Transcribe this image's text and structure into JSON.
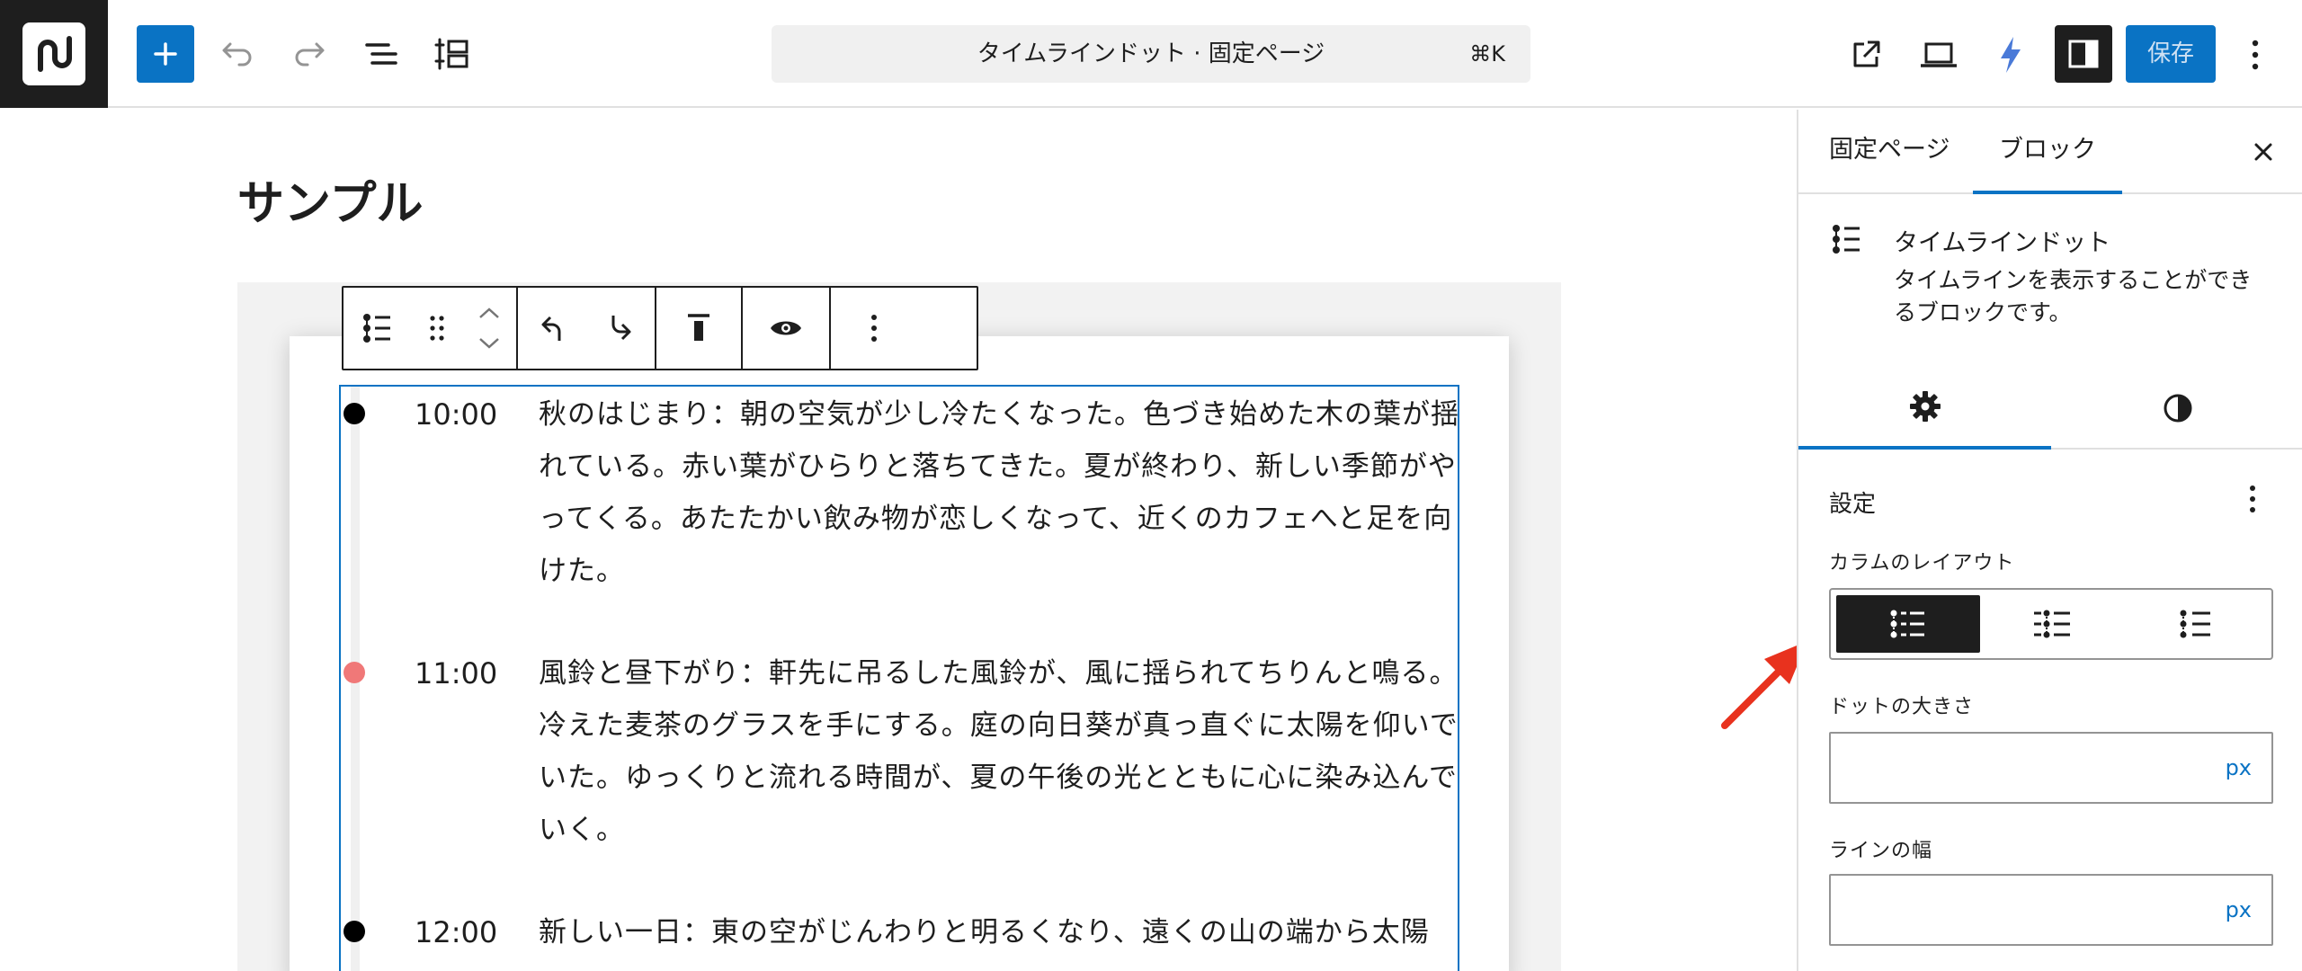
{
  "toolbar": {
    "command_title": "タイムラインドット · 固定ページ",
    "command_shortcut": "⌘K",
    "save_label": "保存"
  },
  "editor": {
    "page_title": "サンプル",
    "timeline": [
      {
        "time": "10:00",
        "text": "秋のはじまり：朝の空気が少し冷たくなった。色づき始めた木の葉が揺れている。赤い葉がひらりと落ちてきた。夏が終わり、新しい季節がやってくる。あたたかい飲み物が恋しくなって、近くのカフェへと足を向けた。",
        "dot_color": "#000000"
      },
      {
        "time": "11:00",
        "text": "風鈴と昼下がり：軒先に吊るした風鈴が、風に揺られてちりんと鳴る。冷えた麦茶のグラスを手にする。庭の向日葵が真っ直ぐに太陽を仰いでいた。ゆっくりと流れる時間が、夏の午後の光とともに心に染み込んでいく。",
        "dot_color": "#f07878"
      },
      {
        "time": "12:00",
        "text": "新しい一日：東の空がじんわりと明るくなり、遠くの山の端から太陽",
        "dot_color": "#000000"
      }
    ]
  },
  "sidebar": {
    "tab_page": "固定ページ",
    "tab_block": "ブロック",
    "block_name": "タイムラインドット",
    "block_description": "タイムラインを表示することができるブロックです。",
    "settings_title": "設定",
    "column_layout_label": "カラムのレイアウト",
    "dot_size_label": "ドットの大きさ",
    "dot_size_unit": "px",
    "line_width_label": "ラインの幅",
    "line_width_unit": "px"
  },
  "colors": {
    "accent": "#0a73c4",
    "dark": "#1e1e1e",
    "dot_pink": "#f07878",
    "annotation_arrow": "#e8321e"
  }
}
